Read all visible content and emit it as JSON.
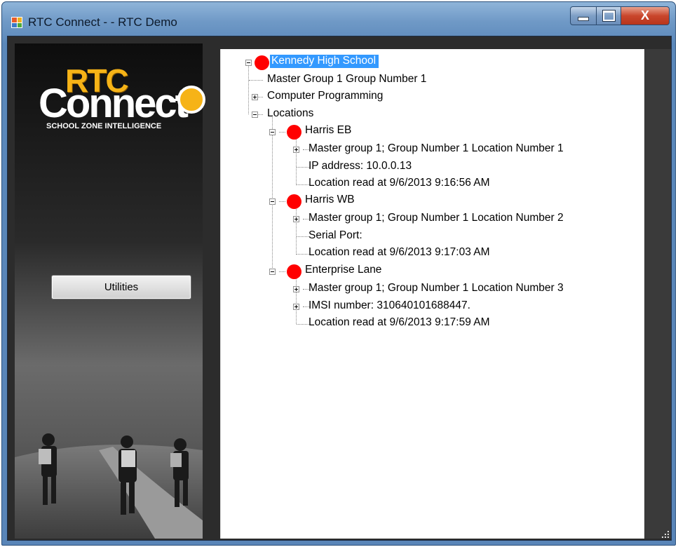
{
  "window": {
    "title": "RTC Connect - -  RTC Demo",
    "controls": {
      "close_label": "X"
    }
  },
  "logo": {
    "rtc": "RTC",
    "connect": "Connect",
    "tagline": "SCHOOL ZONE INTELLIGENCE"
  },
  "sidebar": {
    "utilities_label": "Utilities"
  },
  "tree": {
    "root": "Kennedy High School",
    "items": {
      "master_group": "Master Group 1 Group Number 1",
      "computer_programming": "Computer Programming",
      "locations": "Locations",
      "harris_eb": "Harris EB",
      "harris_eb_master": "Master group 1; Group Number 1 Location Number 1",
      "harris_eb_ip": "IP address: 10.0.0.13",
      "harris_eb_read": "Location read at 9/6/2013 9:16:56 AM",
      "harris_wb": "Harris WB",
      "harris_wb_master": "Master group 1; Group Number 1 Location Number 2",
      "harris_wb_serial": "Serial Port:",
      "harris_wb_read": "Location read at 9/6/2013 9:17:03 AM",
      "enterprise": "Enterprise Lane",
      "enterprise_master": "Master group 1; Group Number 1 Location Number 3",
      "enterprise_imsi": "IMSI number: 310640101688447.",
      "enterprise_read": "Location read at 9/6/2013 9:17:59 AM"
    }
  },
  "colors": {
    "status_dot": "#ff0000",
    "selection": "#3399ff",
    "logo_accent": "#f6b317"
  }
}
